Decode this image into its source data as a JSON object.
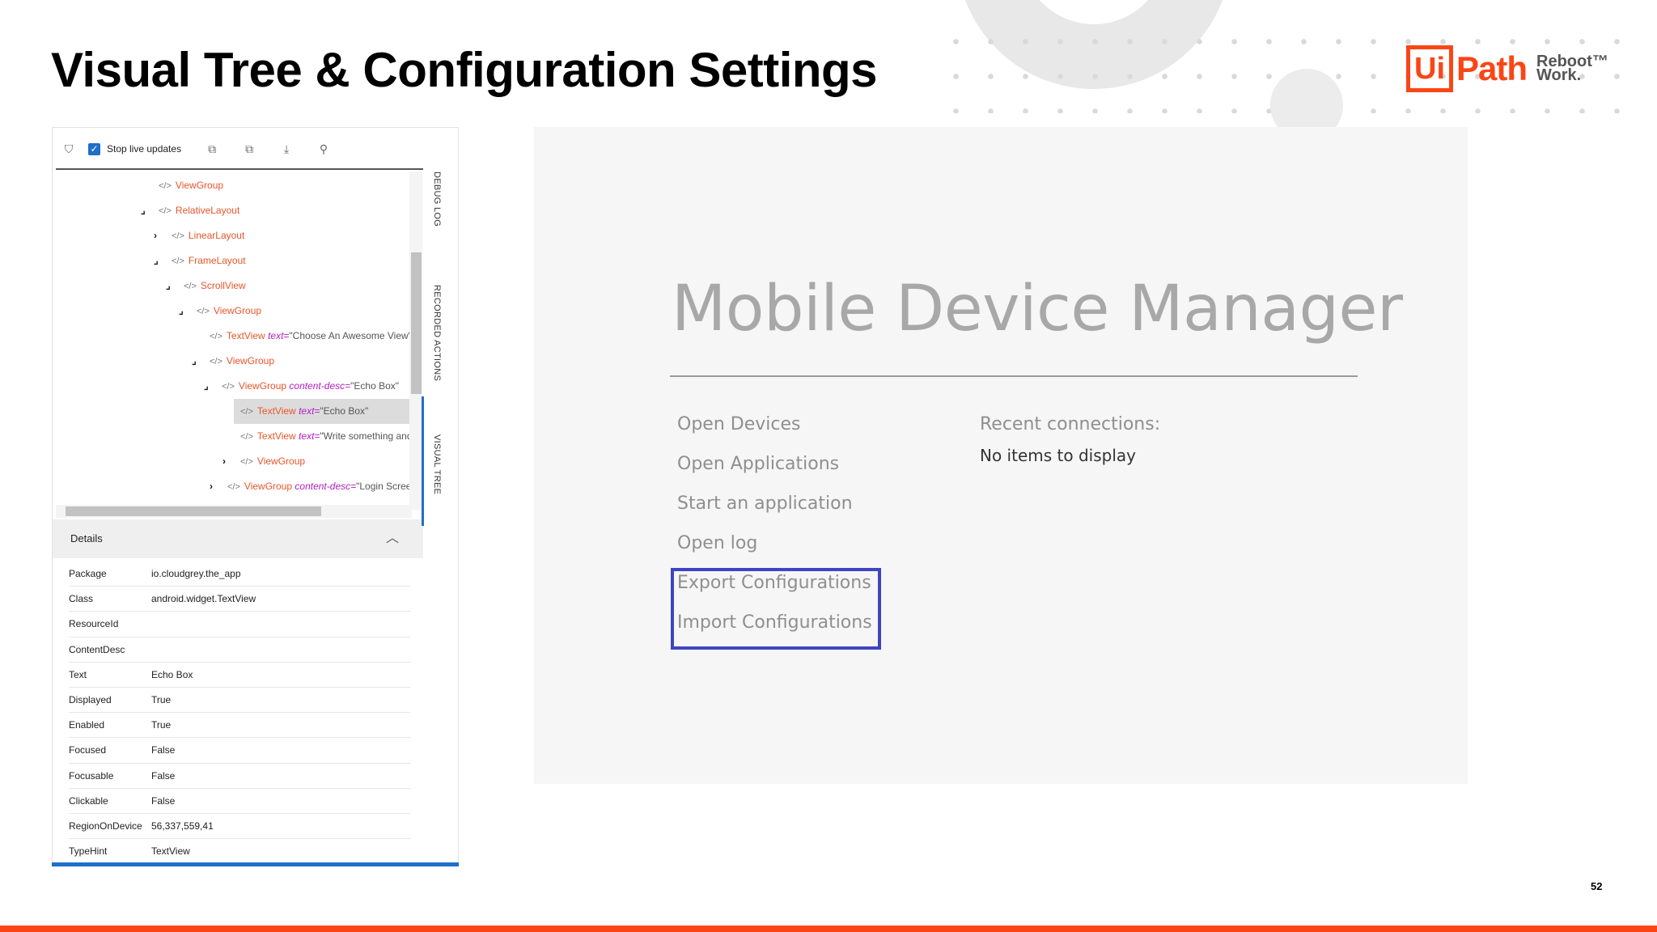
{
  "slide": {
    "title": "Visual Tree & Configuration Settings",
    "page_number": "52"
  },
  "logo": {
    "box_text": "Ui",
    "path_text": "Path",
    "tagline_line1": "Reboot™",
    "tagline_line2": "Work."
  },
  "toolbar": {
    "stop_live_updates": "Stop live updates",
    "checked": true
  },
  "tree": [
    {
      "tag": "ViewGroup",
      "attr": "",
      "value": "",
      "chevron": ""
    },
    {
      "tag": "RelativeLayout",
      "attr": "",
      "value": "",
      "chevron": "⌟"
    },
    {
      "tag": "LinearLayout",
      "attr": "",
      "value": "",
      "chevron": "›"
    },
    {
      "tag": "FrameLayout",
      "attr": "",
      "value": "",
      "chevron": "⌟"
    },
    {
      "tag": "ScrollView",
      "attr": "",
      "value": "",
      "chevron": "⌟"
    },
    {
      "tag": "ViewGroup",
      "attr": "",
      "value": "",
      "chevron": "⌟"
    },
    {
      "tag": "TextView",
      "attr": "text=",
      "value": "\"Choose An Awesome View\"",
      "chevron": ""
    },
    {
      "tag": "ViewGroup",
      "attr": "",
      "value": "",
      "chevron": "⌟"
    },
    {
      "tag": "ViewGroup",
      "attr": "content-desc=",
      "value": "\"Echo Box\"",
      "chevron": "⌟"
    },
    {
      "tag": "TextView",
      "attr": "text=",
      "value": "\"Echo Box\"",
      "chevron": ""
    },
    {
      "tag": "TextView",
      "attr": "text=",
      "value": "\"Write something and s",
      "chevron": ""
    },
    {
      "tag": "ViewGroup",
      "attr": "",
      "value": "",
      "chevron": "›"
    },
    {
      "tag": "ViewGroup",
      "attr": "content-desc=",
      "value": "\"Login Screen\"",
      "chevron": "›"
    }
  ],
  "details": {
    "header": "Details",
    "rows": [
      {
        "key": "Package",
        "value": "io.cloudgrey.the_app"
      },
      {
        "key": "Class",
        "value": "android.widget.TextView"
      },
      {
        "key": "ResourceId",
        "value": ""
      },
      {
        "key": "ContentDesc",
        "value": ""
      },
      {
        "key": "Text",
        "value": "Echo Box"
      },
      {
        "key": "Displayed",
        "value": "True"
      },
      {
        "key": "Enabled",
        "value": "True"
      },
      {
        "key": "Focused",
        "value": "False"
      },
      {
        "key": "Focusable",
        "value": "False"
      },
      {
        "key": "Clickable",
        "value": "False"
      },
      {
        "key": "RegionOnDevice",
        "value": "56,337,559,41"
      },
      {
        "key": "TypeHint",
        "value": "TextView"
      }
    ]
  },
  "side_tabs": {
    "debug_log": "DEBUG LOG",
    "recorded_actions": "RECORDED ACTIONS",
    "visual_tree": "VISUAL TREE"
  },
  "mdm": {
    "title": "Mobile Device Manager",
    "links": [
      "Open Devices",
      "Open Applications",
      "Start an application",
      "Open log",
      "Export Configurations",
      "Import Configurations"
    ],
    "recent_label": "Recent connections:",
    "no_items": "No items to display"
  },
  "colors": {
    "accent": "#fa4616",
    "highlight": "#3f45c0",
    "tag": "#e8552a",
    "attr": "#b21ec2",
    "selection_blue": "#1f6fc9"
  }
}
